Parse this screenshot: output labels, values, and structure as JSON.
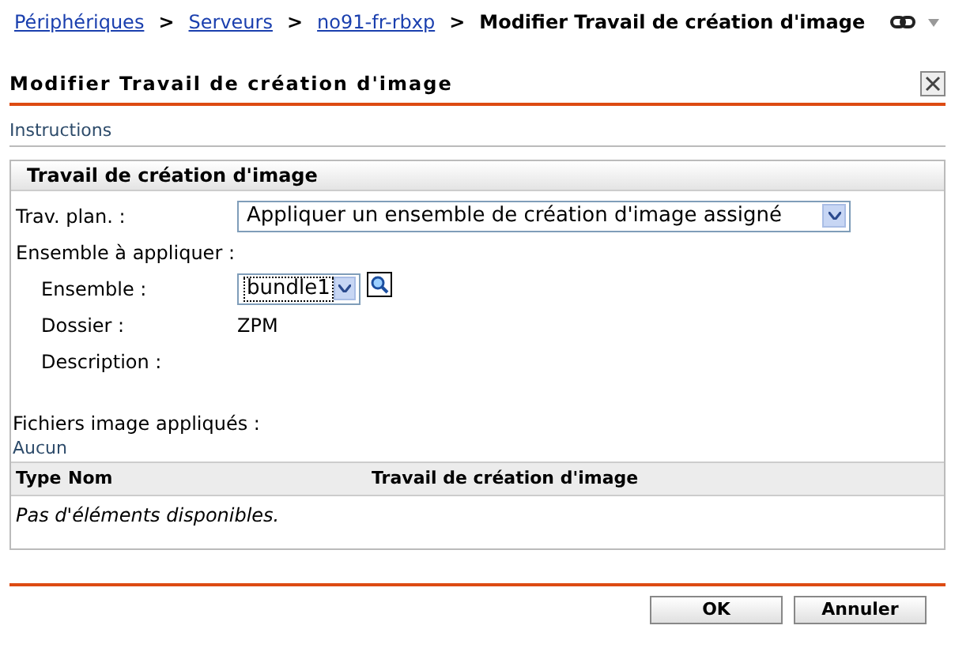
{
  "breadcrumb": {
    "links": [
      "Périphériques",
      "Serveurs",
      "no91-fr-rbxp"
    ],
    "separator": ">",
    "current": "Modifier Travail de création d'image"
  },
  "dialog": {
    "title": "Modifier Travail de création d'image",
    "instructions": "Instructions"
  },
  "section": {
    "title": "Travail de création d'image",
    "fields": [
      {
        "kind": "select",
        "label": "Trav. plan. :",
        "value": "Appliquer un ensemble de création d'image assigné"
      },
      {
        "kind": "heading",
        "label": "Ensemble à appliquer :"
      },
      {
        "kind": "bundle",
        "label": "Ensemble :",
        "value": "bundle1"
      },
      {
        "kind": "text",
        "label": "Dossier :",
        "value": "ZPM"
      },
      {
        "kind": "text",
        "label": "Description :"
      }
    ],
    "files_label": "Fichiers image appliqués :",
    "files_link": "Aucun",
    "table": {
      "columns": [
        "Type",
        "Nom",
        "Travail de création d'image"
      ],
      "empty": "Pas d'éléments disponibles."
    }
  },
  "buttons": [
    "OK",
    "Annuler"
  ]
}
